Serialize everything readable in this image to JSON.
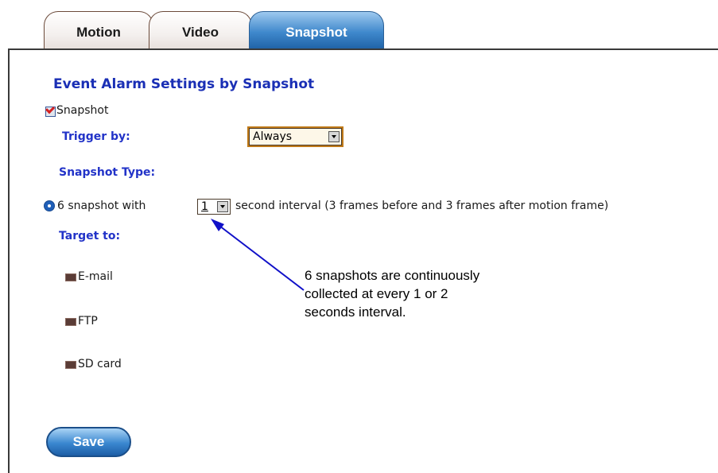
{
  "tabs": [
    {
      "label": "Motion",
      "active": false
    },
    {
      "label": "Video",
      "active": false
    },
    {
      "label": "Snapshot",
      "active": true
    }
  ],
  "settings": {
    "title": "Event Alarm Settings by Snapshot",
    "snapshot_checkbox": {
      "label": "Snapshot",
      "checked": true
    },
    "trigger_label": "Trigger by:",
    "trigger_value": "Always",
    "type_label": "Snapshot Type:",
    "type_option": {
      "prefix": "6 snapshot with",
      "interval_value": "1",
      "suffix": "second interval (3 frames before and 3 frames after motion frame)",
      "selected": true
    },
    "target_label": "Target to:",
    "targets": [
      {
        "label": "E-mail",
        "checked": false
      },
      {
        "label": "FTP",
        "checked": false
      },
      {
        "label": "SD card",
        "checked": false
      }
    ]
  },
  "annotation": {
    "lines": [
      "6 snapshots are continuously",
      "collected at every 1 or 2",
      "seconds interval."
    ]
  },
  "save_label": "Save",
  "colors": {
    "title_blue": "#1a2fb5",
    "label_blue": "#2233c8",
    "tab_active": "#3f88cc",
    "arrow": "#1010c8"
  }
}
